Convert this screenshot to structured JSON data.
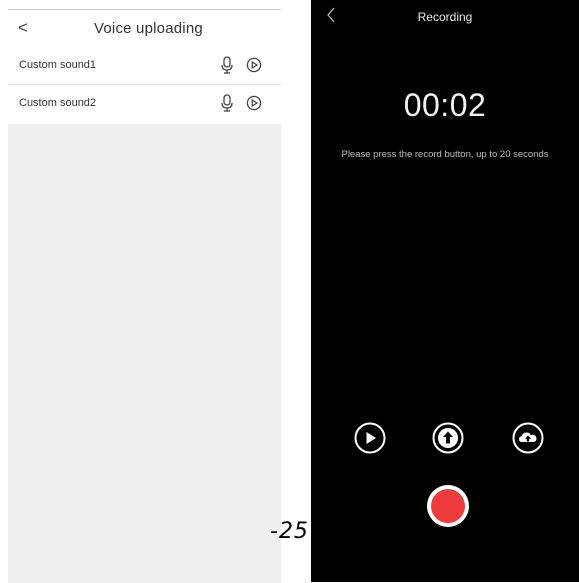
{
  "left_screen": {
    "back_glyph": "<",
    "title": "Voice uploading",
    "items": [
      {
        "label": "Custom sound1",
        "mic_icon": "microphone-icon",
        "play_icon": "play-circle-icon"
      },
      {
        "label": "Custom sound2",
        "mic_icon": "microphone-icon",
        "play_icon": "play-circle-icon"
      }
    ]
  },
  "right_screen": {
    "title": "Recording",
    "timer": "00:02",
    "hint": "Please press the record button, up to 20 seconds",
    "controls": [
      {
        "name": "play",
        "icon": "play-circle-icon"
      },
      {
        "name": "upload",
        "icon": "arrow-up-circle-icon"
      },
      {
        "name": "cloud",
        "icon": "cloud-upload-icon"
      }
    ],
    "record_color": "#ee3b3b"
  },
  "overlay_text": "-25"
}
